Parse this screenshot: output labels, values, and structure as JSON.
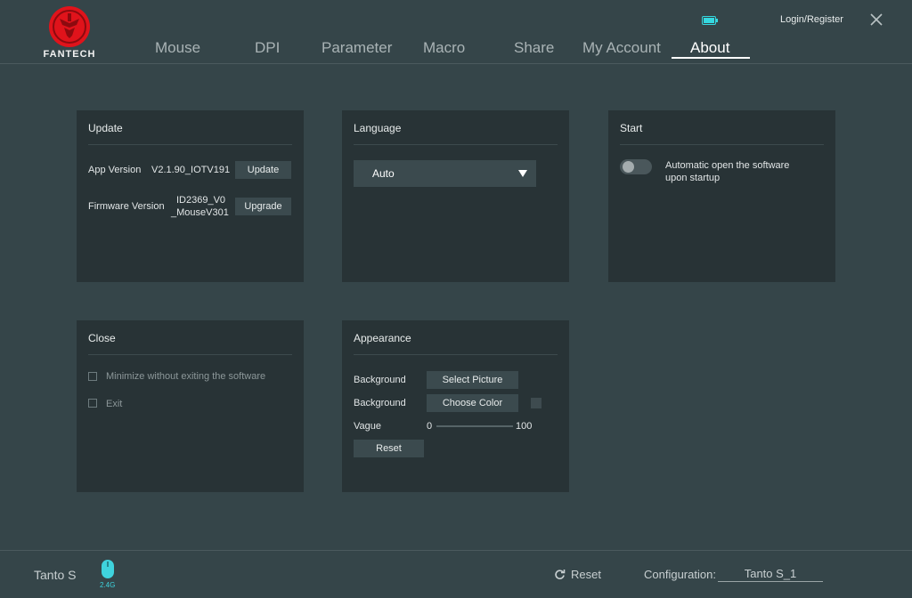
{
  "brand": {
    "logo_text": "FANTECH",
    "logo_color": "#e0131b"
  },
  "header": {
    "tabs": [
      "Mouse",
      "DPI",
      "Parameter",
      "Macro",
      "Share",
      "My Account",
      "About"
    ],
    "active_tab": "About",
    "login_label": "Login/Register",
    "battery_color": "#35d8e0"
  },
  "update": {
    "title": "Update",
    "app_version_label": "App Version",
    "app_version_value": "V2.1.90_IOTV191",
    "update_button": "Update",
    "firmware_label": "Firmware Version",
    "firmware_value_line1": "ID2369_V0",
    "firmware_value_line2": "_MouseV301",
    "upgrade_button": "Upgrade"
  },
  "language": {
    "title": "Language",
    "selected": "Auto"
  },
  "start": {
    "title": "Start",
    "auto_open_line1": "Automatic open the software",
    "auto_open_line2": "upon startup",
    "auto_open_enabled": false
  },
  "close": {
    "title": "Close",
    "option_minimize": "Minimize without exiting the software",
    "option_exit": "Exit"
  },
  "appearance": {
    "title": "Appearance",
    "background_label_1": "Background",
    "select_picture_button": "Select Picture",
    "background_label_2": "Background",
    "choose_color_button": "Choose Color",
    "vague_label": "Vague",
    "vague_min": "0",
    "vague_max": "100",
    "reset_button": "Reset"
  },
  "footer": {
    "device_name": "Tanto S",
    "connection_mode": "2.4G",
    "reset_label": "Reset",
    "configuration_label": "Configuration:",
    "configuration_value": "Tanto S_1"
  }
}
